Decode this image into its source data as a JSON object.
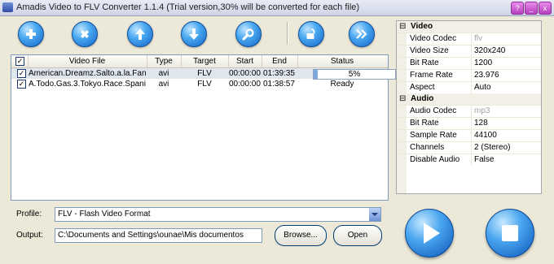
{
  "window": {
    "title": "Amadis Video to FLV Converter 1.1.4 (Trial version,30% will be converted for each file)",
    "controls": [
      "?",
      "_",
      "x"
    ]
  },
  "toolbar": {
    "buttons": [
      {
        "name": "add-button",
        "icon": "plus-icon"
      },
      {
        "name": "remove-button",
        "icon": "x-icon"
      },
      {
        "name": "move-up-button",
        "icon": "arrow-up-icon"
      },
      {
        "name": "move-down-button",
        "icon": "arrow-down-icon"
      },
      {
        "name": "search-button",
        "icon": "search-icon"
      },
      {
        "name": "unlock-button",
        "icon": "padlock-icon"
      },
      {
        "name": "next-button",
        "icon": "double-chevron-right-icon"
      }
    ]
  },
  "filelist": {
    "columns": [
      "Video File",
      "Type",
      "Target",
      "Start",
      "End",
      "Status"
    ],
    "rows": [
      {
        "file": "American.Dreamz.Salto.a.la.Fan",
        "type": "avi",
        "target": "FLV",
        "start": "00:00:00",
        "end": "01:39:35",
        "status": "5%",
        "progress": 0.05,
        "checked": true,
        "selected": true
      },
      {
        "file": "A.Todo.Gas.3.Tokyo.Race.Spani",
        "type": "avi",
        "target": "FLV",
        "start": "00:00:00",
        "end": "01:38:57",
        "status": "Ready",
        "checked": true,
        "selected": false
      }
    ]
  },
  "properties": {
    "video": {
      "title": "Video",
      "rows": [
        {
          "k": "Video Codec",
          "v": "flv",
          "dim": true
        },
        {
          "k": "Video Size",
          "v": "320x240"
        },
        {
          "k": "Bit Rate",
          "v": "1200"
        },
        {
          "k": "Frame Rate",
          "v": "23.976"
        },
        {
          "k": "Aspect",
          "v": "Auto"
        }
      ]
    },
    "audio": {
      "title": "Audio",
      "rows": [
        {
          "k": "Audio Codec",
          "v": "mp3",
          "dim": true
        },
        {
          "k": "Bit Rate",
          "v": "128"
        },
        {
          "k": "Sample Rate",
          "v": "44100"
        },
        {
          "k": "Channels",
          "v": "2 (Stereo)"
        },
        {
          "k": "Disable Audio",
          "v": "False"
        }
      ]
    },
    "toggle": "⊟"
  },
  "profile": {
    "label": "Profile:",
    "value": "FLV - Flash Video Format"
  },
  "output": {
    "label": "Output:",
    "path": "C:\\Documents and Settings\\ounae\\Mis documentos",
    "browse": "Browse...",
    "open": "Open"
  },
  "colors": {
    "accent": "#1564c8",
    "selection": "#dfe6ee",
    "window": "#ece9d8"
  }
}
